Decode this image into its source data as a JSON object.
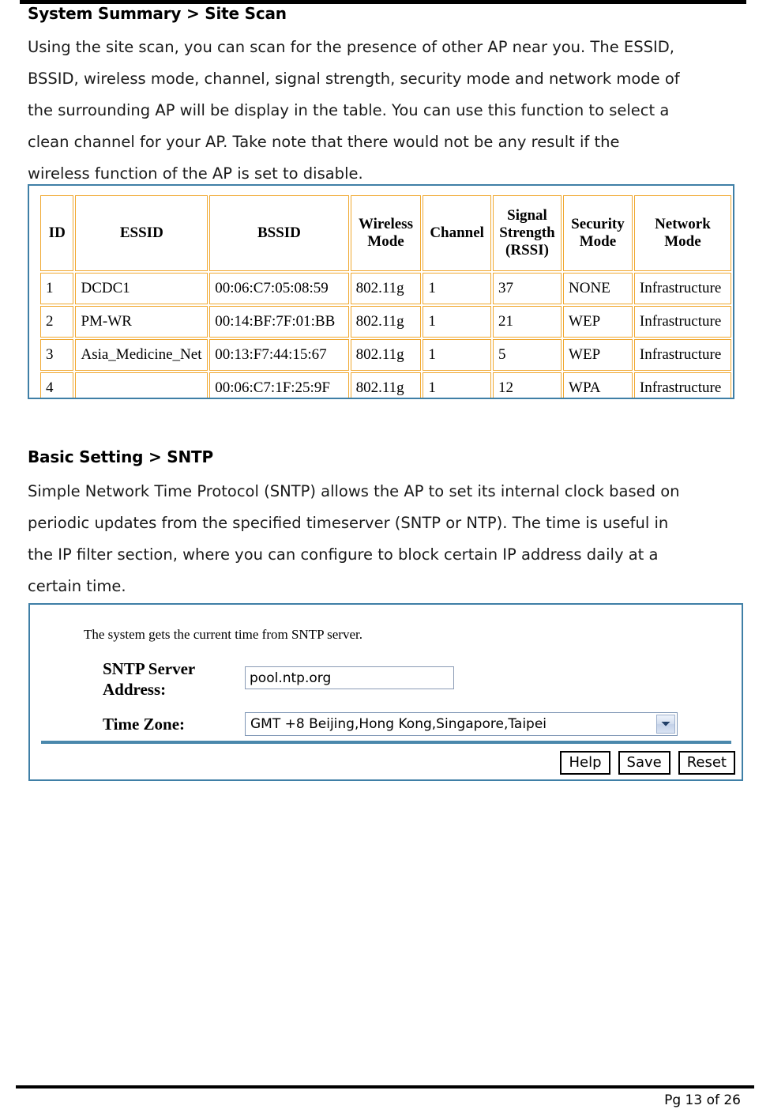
{
  "document": {
    "page_footer": "Pg 13 of 26"
  },
  "sections": [
    {
      "heading": "System Summary > Site Scan",
      "paragraph_lines": [
        "Using the site scan, you can scan for the presence of other AP near you. The ESSID,",
        "BSSID, wireless mode, channel, signal strength, security mode and network mode of",
        "the surrounding AP will be display in the table. You can use this function to select a",
        "clean channel for your AP. Take note that there would not be any result if the",
        "wireless function of the AP is set to disable."
      ]
    },
    {
      "heading": "Basic Setting > SNTP",
      "paragraph_lines": [
        "Simple Network Time Protocol (SNTP) allows the AP to set its internal clock based on",
        "periodic updates from the specified timeserver (SNTP or NTP). The time is useful in",
        "the IP filter section, where you can configure to block certain IP address daily at a",
        "certain time."
      ]
    }
  ],
  "site_scan_table": {
    "columns": [
      "ID",
      "ESSID",
      "BSSID",
      "Wireless Mode",
      "Channel",
      "Signal Strength (RSSI)",
      "Security Mode",
      "Network Mode"
    ],
    "column_lines": [
      [
        "ID"
      ],
      [
        "ESSID"
      ],
      [
        "BSSID"
      ],
      [
        "Wireless",
        "Mode"
      ],
      [
        "Channel"
      ],
      [
        "Signal",
        "Strength",
        "(RSSI)"
      ],
      [
        "Security",
        "Mode"
      ],
      [
        "Network",
        "Mode"
      ]
    ],
    "rows": [
      {
        "id": "1",
        "essid": "DCDC1",
        "bssid": "00:06:C7:05:08:59",
        "wireless_mode": "802.11g",
        "channel": "1",
        "rssi": "37",
        "security_mode": "NONE",
        "network_mode": "Infrastructure"
      },
      {
        "id": "2",
        "essid": "PM-WR",
        "bssid": "00:14:BF:7F:01:BB",
        "wireless_mode": "802.11g",
        "channel": "1",
        "rssi": "21",
        "security_mode": "WEP",
        "network_mode": "Infrastructure"
      },
      {
        "id": "3",
        "essid": "Asia_Medicine_Net",
        "bssid": "00:13:F7:44:15:67",
        "wireless_mode": "802.11g",
        "channel": "1",
        "rssi": "5",
        "security_mode": "WEP",
        "network_mode": "Infrastructure"
      },
      {
        "id": "4",
        "essid": "",
        "bssid": "00:06:C7:1F:25:9F",
        "wireless_mode": "802.11g",
        "channel": "1",
        "rssi": "12",
        "security_mode": "WPA",
        "network_mode": "Infrastructure"
      }
    ]
  },
  "sntp_panel": {
    "note": "The system gets the current time from SNTP server.",
    "server_label_line1": "SNTP Server",
    "server_label_line2": "Address:",
    "server_value": "pool.ntp.org",
    "timezone_label": "Time Zone:",
    "timezone_value": "GMT +8 Beijing,Hong Kong,Singapore,Taipei",
    "buttons": {
      "help": "Help",
      "save": "Save",
      "reset": "Reset"
    }
  },
  "colors": {
    "panel_border": "#3f7fa6",
    "table_cell_border": "#f0a830",
    "rule": "#000000",
    "separator": "#4a88ac"
  }
}
